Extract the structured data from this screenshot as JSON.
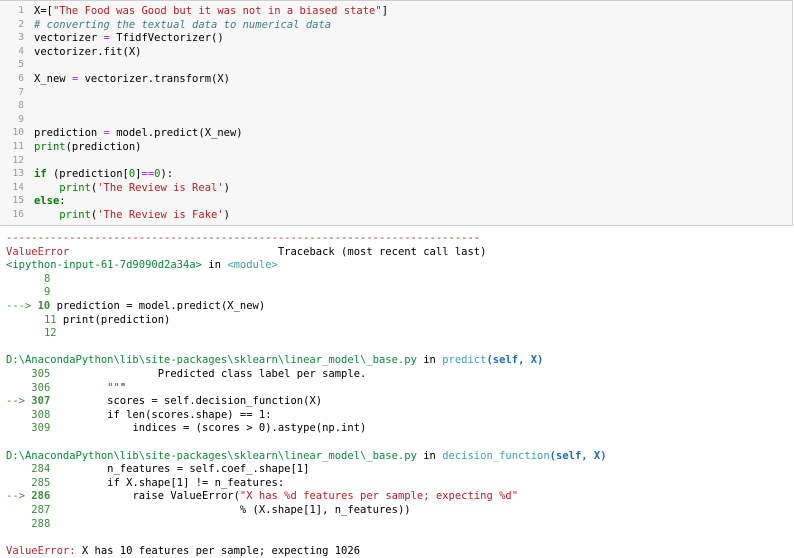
{
  "input_cell": {
    "lines": [
      {
        "n": "1",
        "html": "X=[<span class='str'>\"The Food was Good but it was not in a biased state\"</span>]"
      },
      {
        "n": "2",
        "html": "<span class='cm'># converting the textual data to numerical data</span>"
      },
      {
        "n": "3",
        "html": "vectorizer <span class='op'>=</span> TfidfVectorizer()"
      },
      {
        "n": "4",
        "html": "vectorizer.fit(X)"
      },
      {
        "n": "5",
        "html": ""
      },
      {
        "n": "6",
        "html": "X_new <span class='op'>=</span> vectorizer.transform(X)"
      },
      {
        "n": "7",
        "html": ""
      },
      {
        "n": "8",
        "html": ""
      },
      {
        "n": "9",
        "html": ""
      },
      {
        "n": "10",
        "html": "prediction <span class='op'>=</span> model.predict(X_new)"
      },
      {
        "n": "11",
        "html": "<span class='bi'>print</span>(prediction)"
      },
      {
        "n": "12",
        "html": ""
      },
      {
        "n": "13",
        "html": "<span class='kw'>if</span> (prediction[<span class='num'>0</span>]<span class='op'>==</span><span class='num'>0</span>):"
      },
      {
        "n": "14",
        "html": "    <span class='bi'>print</span>(<span class='str'>'The Review is Real'</span>)"
      },
      {
        "n": "15",
        "html": "<span class='kw'>else</span>:"
      },
      {
        "n": "16",
        "html": "    <span class='bi'>print</span>(<span class='str'>'The Review is Fake'</span>)"
      }
    ]
  },
  "output": {
    "separator": "---------------------------------------------------------------------------",
    "error_name": "ValueError",
    "traceback_label": "Traceback (most recent call last)",
    "input_ref": "<ipython-input-61-7d9090d2a34a>",
    "in_word": "in",
    "module": "<module>",
    "frame1": [
      {
        "arrow": "",
        "n": "8",
        "code": ""
      },
      {
        "arrow": "",
        "n": "9",
        "code": ""
      },
      {
        "arrow": "---> ",
        "n": "10",
        "code": "prediction = model.predict(X_new)"
      },
      {
        "arrow": "",
        "n": "11",
        "code": "print(prediction)"
      },
      {
        "arrow": "",
        "n": "12",
        "code": ""
      }
    ],
    "file1": "D:\\AnacondaPython\\lib\\site-packages\\sklearn\\linear_model\\_base.py",
    "func1": "predict",
    "args1": "(self, X)",
    "frame2": [
      {
        "arrow": "",
        "n": "305",
        "code": "        Predicted class label per sample."
      },
      {
        "arrow": "",
        "n": "306",
        "code": "\"\"\""
      },
      {
        "arrow": "--> ",
        "n": "307",
        "code": "scores = self.decision_function(X)"
      },
      {
        "arrow": "",
        "n": "308",
        "code": "if len(scores.shape) == 1:"
      },
      {
        "arrow": "",
        "n": "309",
        "code": "    indices = (scores > 0).astype(np.int)"
      }
    ],
    "file2": "D:\\AnacondaPython\\lib\\site-packages\\sklearn\\linear_model\\_base.py",
    "func2": "decision_function",
    "args2": "(self, X)",
    "frame3": [
      {
        "arrow": "",
        "n": "284",
        "code": "n_features = self.coef_.shape[1]"
      },
      {
        "arrow": "",
        "n": "285",
        "code": "if X.shape[1] != n_features:"
      },
      {
        "arrow": "--> ",
        "n": "286",
        "code": "    raise ValueError(\"X has %d features per sample; expecting %d\""
      },
      {
        "arrow": "",
        "n": "287",
        "code": "                     % (X.shape[1], n_features))"
      },
      {
        "arrow": "",
        "n": "288",
        "code": ""
      }
    ],
    "final_error_name": "ValueError:",
    "final_message": " X has 10 features per sample; expecting 1026"
  }
}
